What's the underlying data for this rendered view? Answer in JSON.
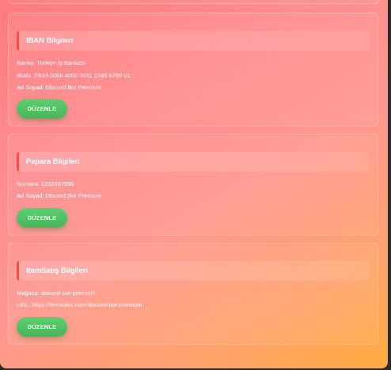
{
  "cards": [
    {
      "title": "IBAN Bilgileri",
      "lines": [
        "Banka: Türkiye İş Bankası",
        "IBAN: TR33 0006 4000 0011 2345 6789 01",
        "Ad Soyad: Discord Bot Premium"
      ],
      "button": "DÜZENLE"
    },
    {
      "title": "Papara Bilgileri",
      "lines": [
        "Numara: 1234567890",
        "Ad Soyad: Discord Bot Premium"
      ],
      "button": "DÜZENLE"
    },
    {
      "title": "ItemSatış Bilgileri",
      "lines": [
        "Mağaza: discord-bot-premium",
        "URL: https://itemsatis.com/discord-bot-premium"
      ],
      "button": "DÜZENLE"
    }
  ],
  "colors": {
    "accent_border": "#ff4b3b",
    "button_green": "#4fbf63",
    "background_start": "#ff7b7f",
    "background_end": "#ffab3f"
  }
}
